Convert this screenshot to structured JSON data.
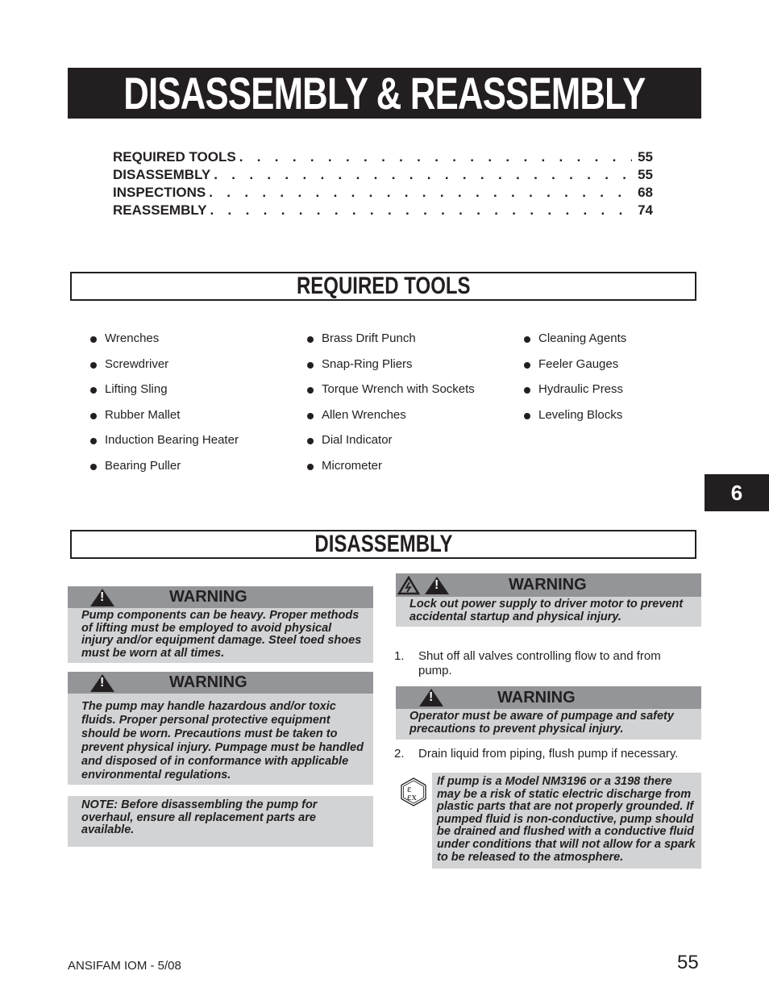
{
  "header": {
    "title": "DISASSEMBLY & REASSEMBLY"
  },
  "toc": [
    {
      "label": "REQUIRED TOOLS",
      "page": "55"
    },
    {
      "label": "DISASSEMBLY",
      "page": "55"
    },
    {
      "label": "INSPECTIONS",
      "page": "68"
    },
    {
      "label": "REASSEMBLY",
      "page": "74"
    }
  ],
  "toc_dots": ". . . . . . . . . . . . . . . . . . . . . . . . . . . . . . . . . . . . . . . .",
  "required_tools": {
    "heading": "REQUIRED TOOLS",
    "columns": [
      [
        "Wrenches",
        "Screwdriver",
        "Lifting Sling",
        "Rubber Mallet",
        "Induction Bearing Heater",
        "Bearing Puller"
      ],
      [
        "Brass Drift Punch",
        "Snap-Ring Pliers",
        "Torque Wrench with Sockets",
        "Allen Wrenches",
        "Dial Indicator",
        "Micrometer"
      ],
      [
        "Cleaning Agents",
        "Feeler Gauges",
        "Hydraulic Press",
        "Leveling Blocks"
      ]
    ]
  },
  "chapter_tab": "6",
  "disassembly": {
    "heading": "DISASSEMBLY",
    "left": {
      "warning1": {
        "title": "WARNING",
        "text": "Pump components can be heavy. Proper methods of lifting must be employed to avoid physical injury and/or equipment damage. Steel toed shoes must be worn at all times."
      },
      "warning2": {
        "title": "WARNING",
        "text": "The pump may handle hazardous and/or toxic fluids. Proper personal protective equipment should be worn. Precautions must be taken to prevent physical injury. Pumpage must be handled and disposed of in conformance with applicable environmental regulations."
      },
      "note": "NOTE:  Before disassembling the pump for overhaul, ensure all replacement parts are available."
    },
    "right": {
      "warning1": {
        "title": "WARNING",
        "text": "Lock out power supply to driver motor to prevent accidental startup and physical injury."
      },
      "step1": {
        "num": "1.",
        "text": "Shut off all valves controlling flow to and from pump."
      },
      "warning2": {
        "title": "WARNING",
        "text": "Operator must be aware of pumpage and safety precautions to prevent physical injury."
      },
      "step2": {
        "num": "2.",
        "text": "Drain liquid from piping, flush pump if necessary."
      },
      "atex_note": "If pump is a Model NM3196 or a 3198 there may be a risk of static electric discharge from plastic parts that are not properly grounded.  If pumped fluid is non-conductive, pump should be drained and flushed with a conductive fluid under conditions that will not allow for a spark to be released to the atmosphere."
    }
  },
  "footer": {
    "doc_id": "ANSIFAM IOM - 5/08",
    "page_number": "55"
  }
}
